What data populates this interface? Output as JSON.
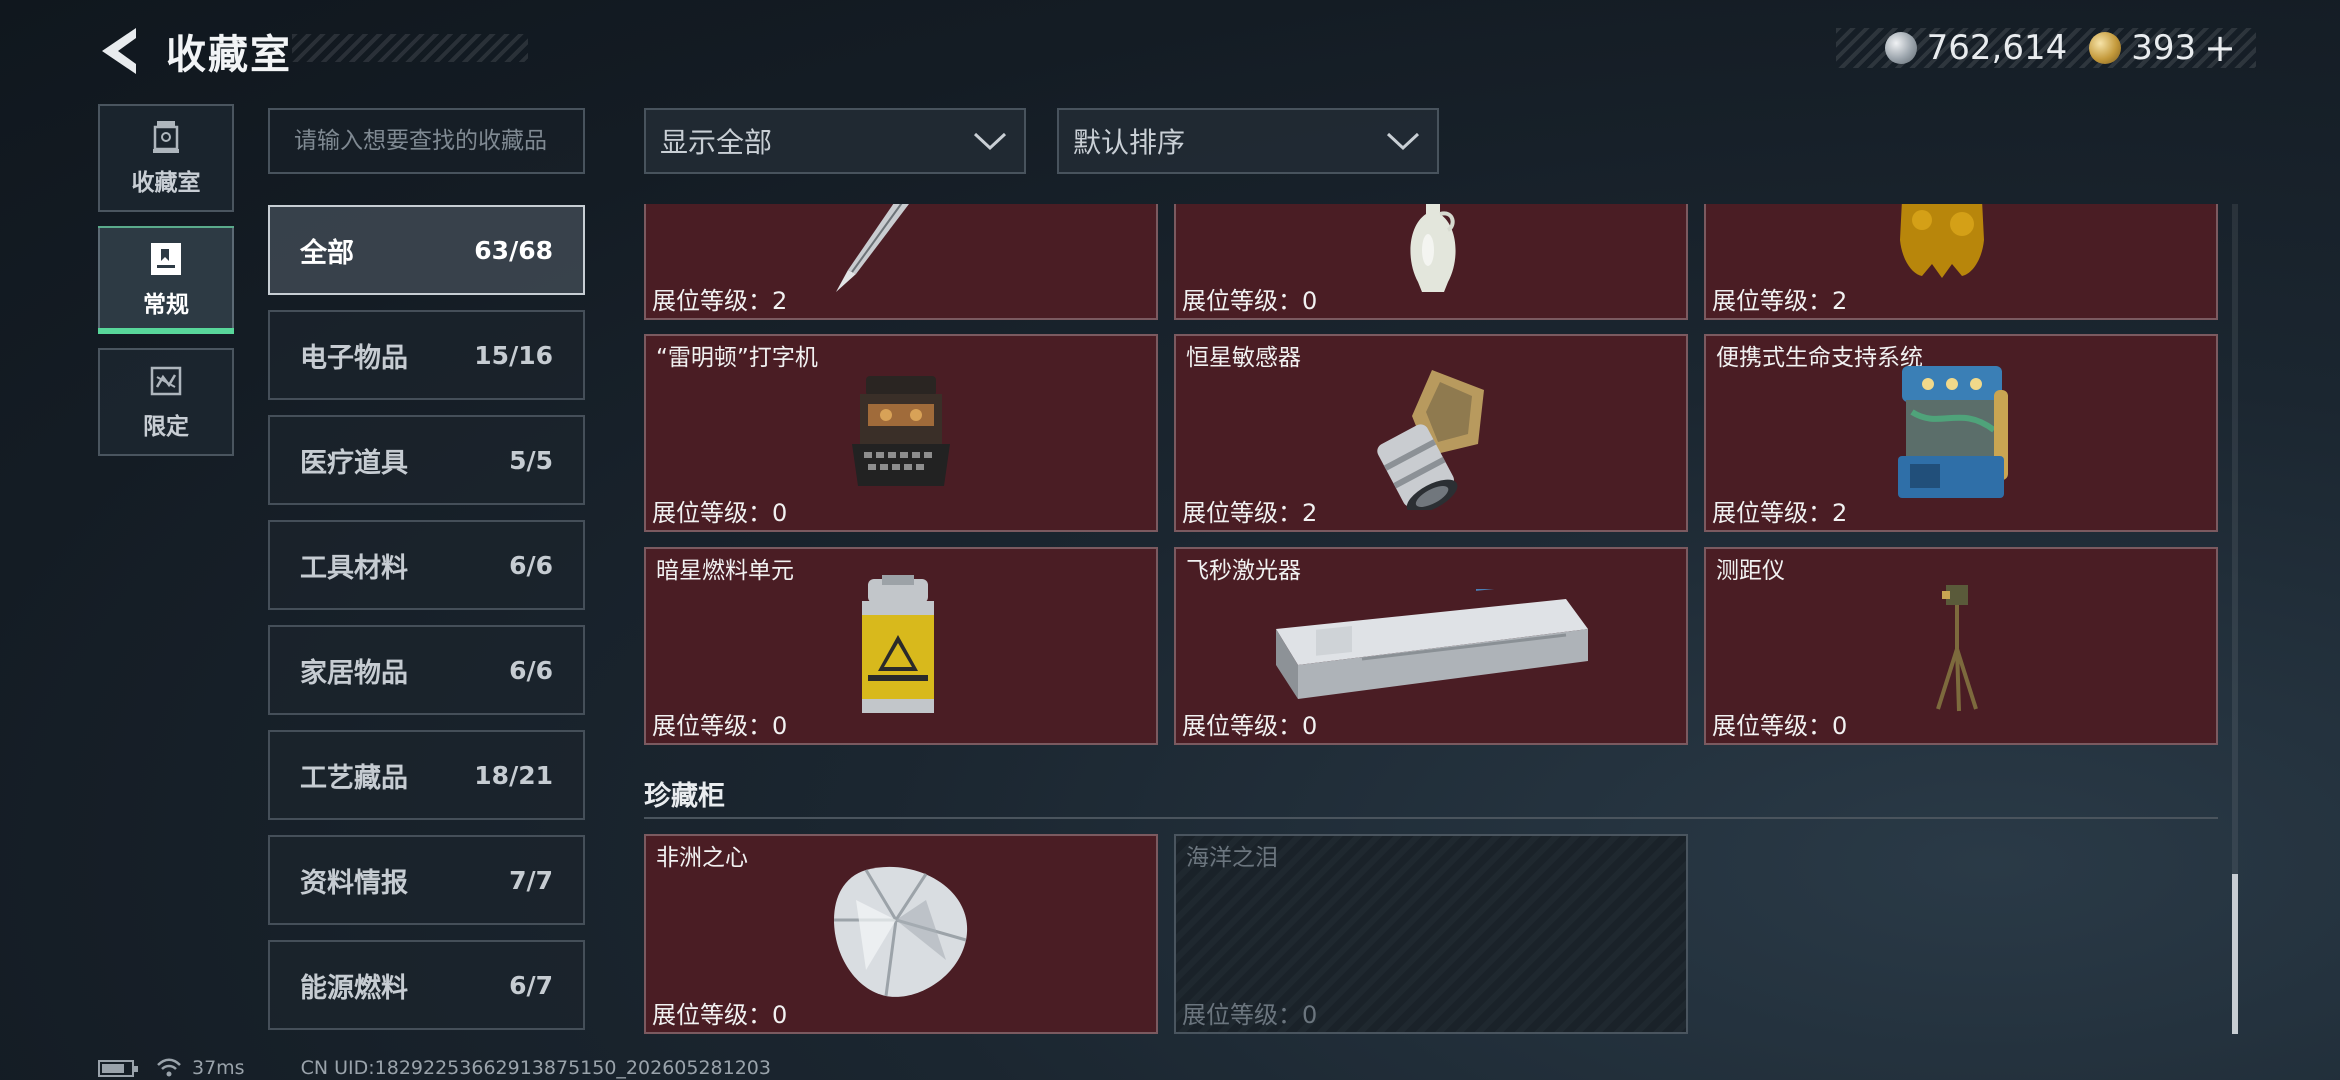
{
  "header": {
    "title": "收藏室",
    "currency": [
      {
        "icon": "silver-coin-icon",
        "value": "762,614"
      },
      {
        "icon": "gold-coin-icon",
        "value": "393"
      }
    ],
    "add_label": "+"
  },
  "side_tabs": [
    {
      "label": "收藏室",
      "icon": "trophy-icon",
      "active": false
    },
    {
      "label": "常规",
      "icon": "document-icon",
      "active": true
    },
    {
      "label": "限定",
      "icon": "limited-icon",
      "active": false
    }
  ],
  "search": {
    "placeholder": "请输入想要查找的收藏品"
  },
  "categories": [
    {
      "name": "全部",
      "count": "63/68",
      "active": true
    },
    {
      "name": "电子物品",
      "count": "15/16"
    },
    {
      "name": "医疗道具",
      "count": "5/5"
    },
    {
      "name": "工具材料",
      "count": "6/6"
    },
    {
      "name": "家居物品",
      "count": "6/6"
    },
    {
      "name": "工艺藏品",
      "count": "18/21"
    },
    {
      "name": "资料情报",
      "count": "7/7"
    },
    {
      "name": "能源燃料",
      "count": "6/7"
    }
  ],
  "filters": {
    "filter_label": "显示全部",
    "sort_label": "默认排序"
  },
  "items": [
    {
      "name": "",
      "level": "展位等级：2",
      "art": "pen"
    },
    {
      "name": "",
      "level": "展位等级：0",
      "art": "vase"
    },
    {
      "name": "",
      "level": "展位等级：2",
      "art": "statue"
    },
    {
      "name": "“雷明顿”打字机",
      "level": "展位等级：0",
      "art": "typewriter"
    },
    {
      "name": "恒星敏感器",
      "level": "展位等级：2",
      "art": "star-sensor"
    },
    {
      "name": "便携式生命支持系统",
      "level": "展位等级：2",
      "art": "life-support"
    },
    {
      "name": "暗星燃料单元",
      "level": "展位等级：0",
      "art": "fuel-canister"
    },
    {
      "name": "飞秒激光器",
      "level": "展位等级：0",
      "art": "laser"
    },
    {
      "name": "测距仪",
      "level": "展位等级：0",
      "art": "rangefinder"
    }
  ],
  "cabinet": {
    "title": "珍藏柜",
    "items": [
      {
        "name": "非洲之心",
        "level": "展位等级：0",
        "locked": false
      },
      {
        "name": "海洋之泪",
        "level": "展位等级：0",
        "locked": true
      }
    ]
  },
  "footer": {
    "ping": "37ms",
    "uid": "CN UID:1829225366291387515​0_202605281203"
  },
  "colors": {
    "card_bg": "#4a1d24",
    "accent_green": "#58d69a"
  }
}
